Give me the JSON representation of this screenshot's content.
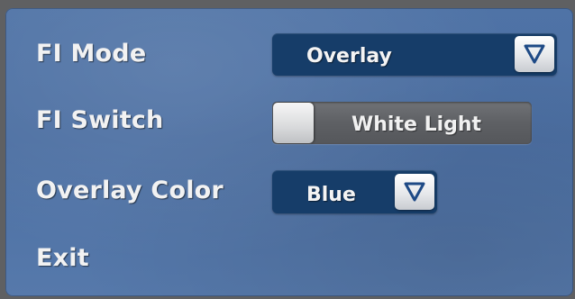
{
  "menu": {
    "fi_mode": {
      "label": "FI Mode",
      "value": "Overlay",
      "icon": "chevron-down-icon"
    },
    "fi_switch": {
      "label": "FI Switch",
      "value": "White Light",
      "state": "off"
    },
    "overlay_color": {
      "label": "Overlay Color",
      "value": "Blue",
      "icon": "chevron-down-icon"
    },
    "exit": {
      "label": "Exit"
    }
  },
  "colors": {
    "panel_blue": "#4f73a6",
    "dropdown_navy": "#163d69",
    "switch_gray": "#5e6064",
    "text": "#f2f2f2",
    "arrow_stroke": "#1e4a86"
  }
}
